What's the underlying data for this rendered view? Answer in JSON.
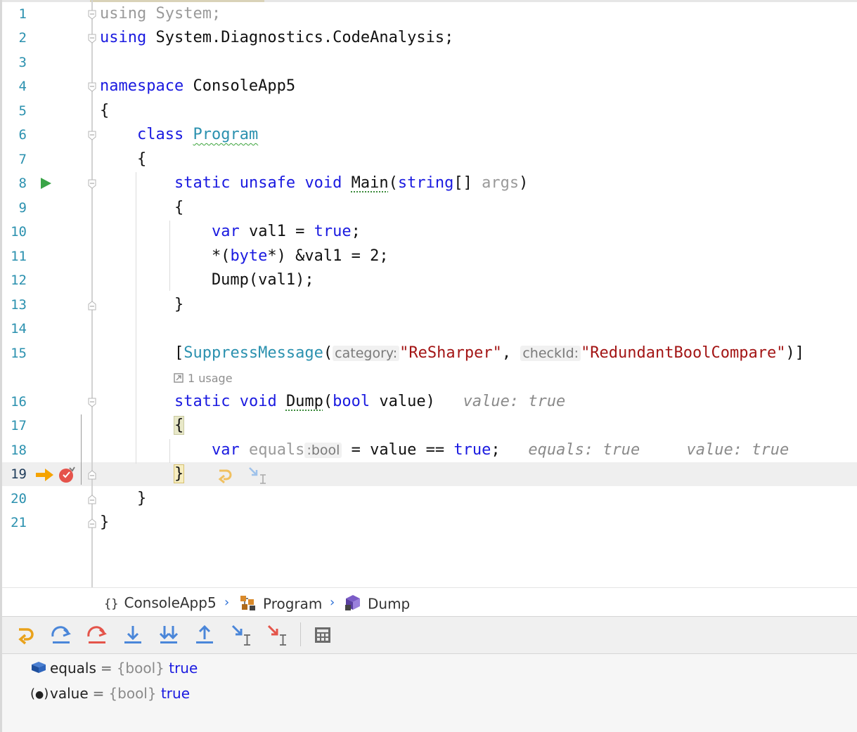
{
  "editor": {
    "lines": [
      {
        "num": "1",
        "tokens": [
          [
            "gray",
            "using System;"
          ]
        ]
      },
      {
        "num": "2",
        "tokens": [
          [
            "kw",
            "using"
          ],
          [
            "",
            " System.Diagnostics.CodeAnalysis;"
          ]
        ]
      },
      {
        "num": "3",
        "tokens": []
      },
      {
        "num": "4",
        "tokens": [
          [
            "kw",
            "namespace"
          ],
          [
            "",
            " ConsoleApp5"
          ]
        ]
      },
      {
        "num": "5",
        "tokens": [
          [
            "",
            "{"
          ]
        ]
      },
      {
        "num": "6",
        "tokens": [
          [
            "",
            "    "
          ],
          [
            "kw",
            "class"
          ],
          [
            "",
            " "
          ],
          [
            "ty squig",
            "Program"
          ]
        ]
      },
      {
        "num": "7",
        "tokens": [
          [
            "",
            "    {"
          ]
        ]
      },
      {
        "num": "8",
        "tokens": [
          [
            "",
            "        "
          ],
          [
            "kw",
            "static"
          ],
          [
            "",
            " "
          ],
          [
            "kw",
            "unsafe"
          ],
          [
            "",
            " "
          ],
          [
            "kw",
            "void"
          ],
          [
            "",
            " "
          ],
          [
            "dotted",
            "Main"
          ],
          [
            "",
            "("
          ],
          [
            "kw",
            "string"
          ],
          [
            "",
            "[] "
          ],
          [
            "gray",
            "args"
          ],
          [
            "",
            ")"
          ]
        ]
      },
      {
        "num": "9",
        "tokens": [
          [
            "",
            "        {"
          ]
        ]
      },
      {
        "num": "10",
        "tokens": [
          [
            "",
            "            "
          ],
          [
            "kw",
            "var"
          ],
          [
            "",
            " val1 = "
          ],
          [
            "kw",
            "true"
          ],
          [
            "",
            ";"
          ]
        ]
      },
      {
        "num": "11",
        "tokens": [
          [
            "",
            "            *("
          ],
          [
            "kw",
            "byte"
          ],
          [
            "",
            "*) &val1 = 2;"
          ]
        ]
      },
      {
        "num": "12",
        "tokens": [
          [
            "",
            "            Dump(val1);"
          ]
        ]
      },
      {
        "num": "13",
        "tokens": [
          [
            "",
            "        }"
          ]
        ]
      },
      {
        "num": "14",
        "tokens": []
      },
      {
        "num": "15",
        "tokens": [
          [
            "",
            "        ["
          ],
          [
            "ty",
            "SuppressMessage"
          ],
          [
            "",
            "("
          ],
          [
            "hint",
            "category:"
          ],
          [
            "str",
            "\"ReSharper\""
          ],
          [
            "",
            ", "
          ],
          [
            "hint",
            "checkId:"
          ],
          [
            "str",
            "\"RedundantBoolCompare\""
          ],
          [
            "",
            ")]"
          ]
        ]
      },
      {
        "num": "16",
        "tokens": [
          [
            "",
            "        "
          ],
          [
            "kw",
            "static"
          ],
          [
            "",
            " "
          ],
          [
            "kw",
            "void"
          ],
          [
            "",
            " "
          ],
          [
            "dotted",
            "Dump"
          ],
          [
            "",
            "("
          ],
          [
            "kw",
            "bool"
          ],
          [
            "",
            " value)   "
          ],
          [
            "inlay",
            "value: true"
          ]
        ]
      },
      {
        "num": "17",
        "tokens": [
          [
            "",
            "        "
          ],
          [
            "brace-hl",
            "{"
          ]
        ]
      },
      {
        "num": "18",
        "tokens": [
          [
            "",
            "            "
          ],
          [
            "kw",
            "var"
          ],
          [
            "",
            " "
          ],
          [
            "gray",
            "equals"
          ],
          [
            "hint",
            ":bool"
          ],
          [
            "",
            " = value == "
          ],
          [
            "kw",
            "true"
          ],
          [
            "",
            ";   "
          ],
          [
            "inlay",
            "equals: true     value: true"
          ]
        ]
      },
      {
        "num": "19",
        "tokens": [
          [
            "",
            "        "
          ],
          [
            "brace-yel",
            "}"
          ]
        ]
      },
      {
        "num": "20",
        "tokens": [
          [
            "",
            "    }"
          ]
        ]
      },
      {
        "num": "21",
        "tokens": [
          [
            "",
            "}"
          ]
        ]
      }
    ],
    "usage_text": "1 usage",
    "current_line": "19"
  },
  "breadcrumb": {
    "items": [
      {
        "label": "ConsoleApp5",
        "icon": "namespace-icon"
      },
      {
        "label": "Program",
        "icon": "class-icon"
      },
      {
        "label": "Dump",
        "icon": "method-icon"
      }
    ],
    "separator": "›"
  },
  "toolbar": {
    "buttons": [
      "show-execution-point",
      "step-over",
      "step-over-red",
      "step-into",
      "force-step-into",
      "step-out",
      "run-to-cursor",
      "force-run-to-cursor",
      "evaluate-expression"
    ]
  },
  "variables": [
    {
      "name": "equals",
      "eq": "=",
      "type": "{bool}",
      "value": "true",
      "icon": "variable-icon"
    },
    {
      "name": "value",
      "eq": "=",
      "type": "{bool}",
      "value": "true",
      "icon": "parameter-icon"
    }
  ],
  "colors": {
    "keyword": "#1a1ae0",
    "type": "#2b91af",
    "string": "#a31515",
    "line_number": "#2b91af"
  }
}
